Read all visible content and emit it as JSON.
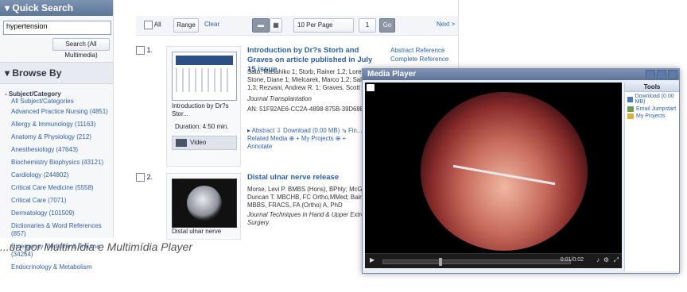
{
  "left_panel": {
    "quick_search": {
      "title": "▾ Quick Search",
      "input_value": "hypertension",
      "button_label": "Search (All Multimedia)"
    },
    "browse": {
      "title": "▾ Browse By"
    },
    "subject": {
      "heading": "- Subject/Category",
      "all_label": "All Subject/Categories",
      "items": [
        "Advanced Practice Nursing (4851)",
        "Allergy & Immunology (11163)",
        "Anatomy & Physiology (212)",
        "Anesthesiology (47643)",
        "Biochemistry Biophysics (43121)",
        "Cardiology (244802)",
        "Critical Care Medicine (5558)",
        "Critical Care (7071)",
        "Dermatology (101509)",
        "Dictionaries & Word References (857)",
        "Emergency Medicine & Trauma (34264)",
        "Endocrinology & Metabolism"
      ]
    }
  },
  "toolbar": {
    "all_label": "All",
    "range_label": "Range",
    "clear_label": "Clear",
    "per_page": "10 Per Page",
    "page_number": "1",
    "go_label": "Go",
    "next_label": "Next >"
  },
  "results": [
    {
      "number": "1.",
      "title": "Introduction by Dr?s Storb and Graves on article published in July 15 issue",
      "authors": "Sato, Masahiko 1; Storb, Rainer 1,2; Loretz, Cl... Stone, Diane 1; Mielcarek, Marco 1,2; Sale, Ge... E. 1,3; Rezvani, Andrew R. 1; Graves, Scott S.",
      "journal": "Journal Transplantation",
      "an": "AN: 51F92AE6-CC2A-4898-875B-39D68ECAE...",
      "thumb_caption": "Introduction by Dr?s Stor...",
      "duration": "Duration: 4:50 min.",
      "type_label": "Video",
      "actions": "▸ Abstract   ⇩ Download (0.00 MB)   ⇘ Fin...",
      "related": "Related Media   ⊕ + My Projects   ⊕ +",
      "annotate": "Annotate",
      "side_links": [
        "Abstract Reference",
        "Complete Reference"
      ]
    },
    {
      "number": "2.",
      "title": "Distal ulnar nerve release",
      "authors": "Morse, Levi P. BMBS (Hons), BPhty; McGuire, ... Duncan T. MBCHB, FC Ortho,MMed; Bain, Gre... MBBS, FRACS, FA (Ortho) A, PhD",
      "journal": "Journal Techniques in Hand & Upper Extremit... Surgery",
      "thumb_caption": "Distal ulnar nerve",
      "side_links": []
    }
  ],
  "player": {
    "title": "Media Player",
    "time": "0:01/0:02",
    "tools_title": "Tools",
    "tools": [
      {
        "icon": "download-icon",
        "label": "Download (0.00 MB)"
      },
      {
        "icon": "email-icon",
        "label": "Email Jumpstart"
      },
      {
        "icon": "folder-icon",
        "label": "My Projects"
      }
    ]
  },
  "caption": "...ua por Multimídia e Multimídia Player",
  "colors": {
    "accent": "#2b5fad",
    "header": "#6b82a6"
  }
}
